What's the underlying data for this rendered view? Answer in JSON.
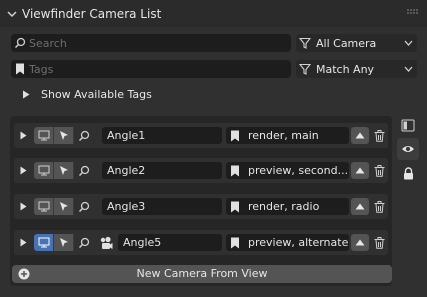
{
  "panel": {
    "title": "Viewfinder Camera List"
  },
  "filters": {
    "search_placeholder": "Search",
    "camera_filter": "All Camera",
    "tags_placeholder": "Tags",
    "tag_match": "Match Any"
  },
  "disclosure": {
    "label": "Show Available Tags"
  },
  "cameras": [
    {
      "name": "Angle1",
      "tags": "render, main",
      "active": false,
      "has_extra_icon": false
    },
    {
      "name": "Angle2",
      "tags": "preview, second...",
      "active": false,
      "has_extra_icon": false
    },
    {
      "name": "Angle3",
      "tags": "render, radio",
      "active": false,
      "has_extra_icon": false
    },
    {
      "name": "Angle5",
      "tags": "preview, alternate",
      "active": true,
      "has_extra_icon": true
    }
  ],
  "actions": {
    "new_camera": "New Camera From View"
  },
  "icons": {
    "collapse": "chevron-down-icon",
    "grip": "drag-grip-icon",
    "search": "search-icon",
    "filter": "funnel-icon",
    "tag": "bookmark-icon",
    "monitor": "monitor-icon",
    "select": "cursor-arrow-icon",
    "zoom": "magnifier-icon",
    "up": "move-up-icon",
    "trash": "trash-icon",
    "add": "plus-circle-icon",
    "side_list": "list-panel-icon",
    "side_view": "eye-icon",
    "side_lock": "lock-icon"
  },
  "colors": {
    "accent": "#4772b3",
    "panel_bg": "#303030",
    "field_bg": "#1d1d1d",
    "button_bg": "#545454"
  }
}
